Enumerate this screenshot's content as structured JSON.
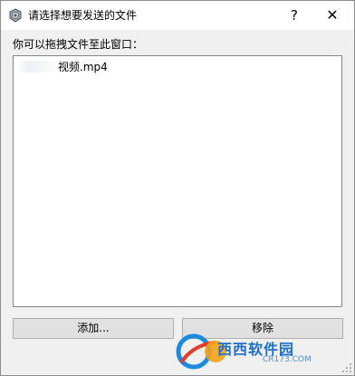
{
  "window": {
    "title": "请选择想要发送的文件",
    "help_label": "?",
    "close_label": "✕"
  },
  "main": {
    "prompt": "你可以拖拽文件至此窗口：",
    "files": [
      {
        "name": "视频.mp4"
      }
    ]
  },
  "buttons": {
    "add_label": "添加...",
    "remove_label": "移除"
  },
  "watermark": {
    "text": "西西软件园",
    "sub": "CR173.COM"
  }
}
